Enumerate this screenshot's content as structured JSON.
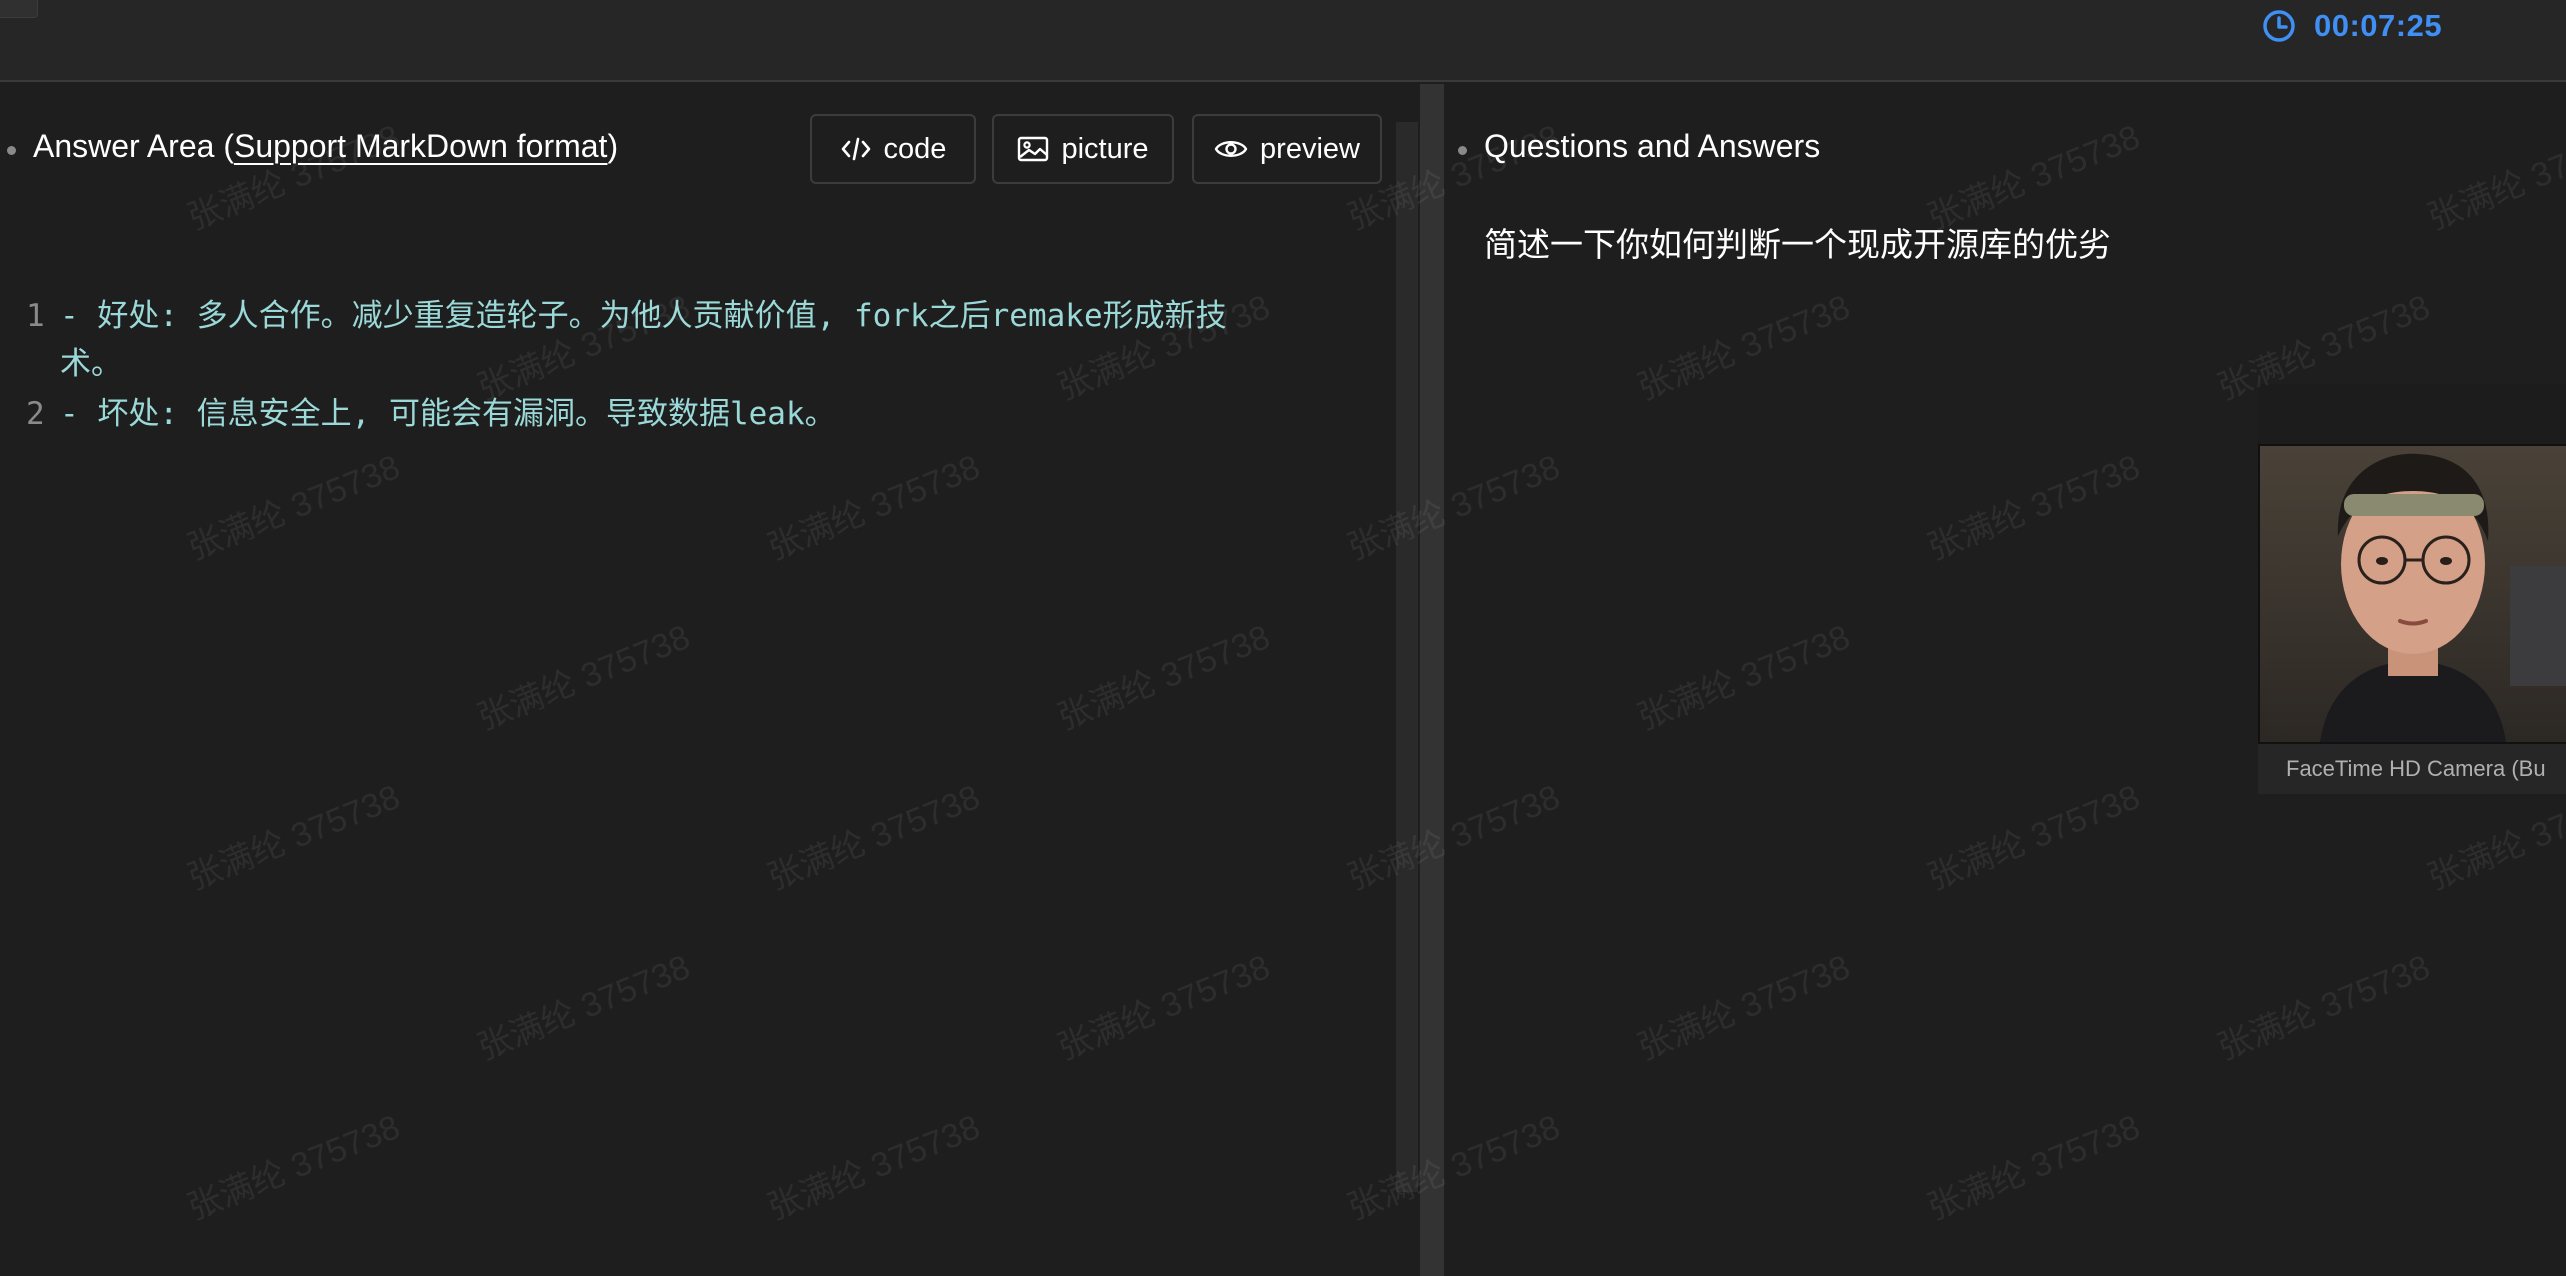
{
  "timer": {
    "value": "00:07:25",
    "icon": "clock-icon",
    "color": "#3f8ff5"
  },
  "answer_area": {
    "title_prefix": "Answer Area (",
    "title_link": "Support MarkDown format",
    "title_suffix": ")",
    "buttons": {
      "code": "code",
      "picture": "picture",
      "preview": "preview"
    },
    "lines": [
      {
        "no": "1",
        "text": "- 好处: 多人合作。减少重复造轮子。为他人贡献价值, fork之后remake形成新技术。"
      },
      {
        "no": "2",
        "text": "- 坏处: 信息安全上, 可能会有漏洞。导致数据leak。"
      }
    ],
    "text_color": "#9bd8d8"
  },
  "qa": {
    "title": "Questions and Answers",
    "question": "简述一下你如何判断一个现成开源库的优劣"
  },
  "camera": {
    "label": "FaceTime HD Camera (Bu"
  },
  "watermark": {
    "text": "张满纶 375738"
  }
}
